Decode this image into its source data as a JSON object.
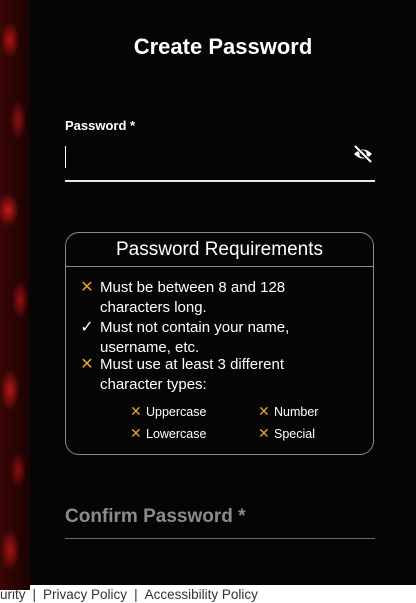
{
  "title": "Create Password",
  "password": {
    "label": "Password *",
    "value": "",
    "toggle_icon": "eye-slash-icon"
  },
  "requirements": {
    "title": "Password Requirements",
    "items": [
      {
        "status": "fail",
        "line1": "Must be between 8 and 128",
        "line2": "characters long."
      },
      {
        "status": "pass",
        "line1": "Must not contain your name,",
        "line2": "username, etc."
      },
      {
        "status": "fail",
        "line1": "Must use at least 3 different",
        "line2": "character types:"
      }
    ],
    "types": [
      {
        "status": "fail",
        "label": "Uppercase"
      },
      {
        "status": "fail",
        "label": "Number"
      },
      {
        "status": "fail",
        "label": "Lowercase"
      },
      {
        "status": "fail",
        "label": "Special"
      }
    ],
    "fail_symbol": "✕",
    "pass_symbol": "✓"
  },
  "confirm": {
    "label": "Confirm Password *"
  },
  "footer": {
    "links": [
      "urity",
      "Privacy Policy",
      "Accessibility Policy"
    ],
    "separator": "|"
  },
  "colors": {
    "background": "#050505",
    "fail": "#e0a32a",
    "pass": "#ffffff",
    "muted_label": "#8c8c8c"
  }
}
